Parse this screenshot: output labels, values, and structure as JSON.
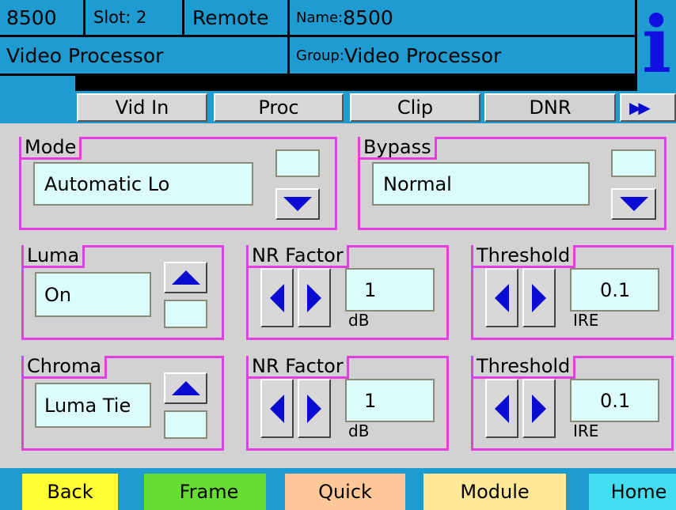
{
  "header": {
    "device": "8500",
    "slot": "Slot: 2",
    "remote": "Remote",
    "name_prefix": "Name:",
    "name_value": "8500",
    "title": "Video Processor",
    "group_prefix": "Group:",
    "group_value": "Video Processor",
    "info_glyph": "i",
    "info_icon": "info-icon"
  },
  "tabs": [
    "Vid In",
    "Proc",
    "Clip",
    "DNR"
  ],
  "tabs_more": "▶▶",
  "mode": {
    "label": "Mode",
    "value": "Automatic Lo"
  },
  "bypass": {
    "label": "Bypass",
    "value": "Normal"
  },
  "luma": {
    "label": "Luma",
    "value": "On",
    "nr_label": "NR Factor",
    "nr_value": "1",
    "nr_unit": "dB",
    "th_label": "Threshold",
    "th_value": "0.1",
    "th_unit": "IRE"
  },
  "chroma": {
    "label": "Chroma",
    "value": "Luma Tie",
    "nr_label": "NR Factor",
    "nr_value": "1",
    "nr_unit": "dB",
    "th_label": "Threshold",
    "th_value": "0.1",
    "th_unit": "IRE"
  },
  "footer": {
    "back": "Back",
    "frame": "Frame",
    "quick": "Quick",
    "module": "Module",
    "home": "Home"
  },
  "colors": {
    "header_blue": "#1e9bd0",
    "group_border": "#e23ee2",
    "field_bg": "#dcfcfc",
    "arrow_blue": "#0a0ad0",
    "back": "#ffff33",
    "frame": "#66dd33",
    "quick": "#ffc896",
    "module": "#ffe898",
    "home": "#44ddf0"
  }
}
